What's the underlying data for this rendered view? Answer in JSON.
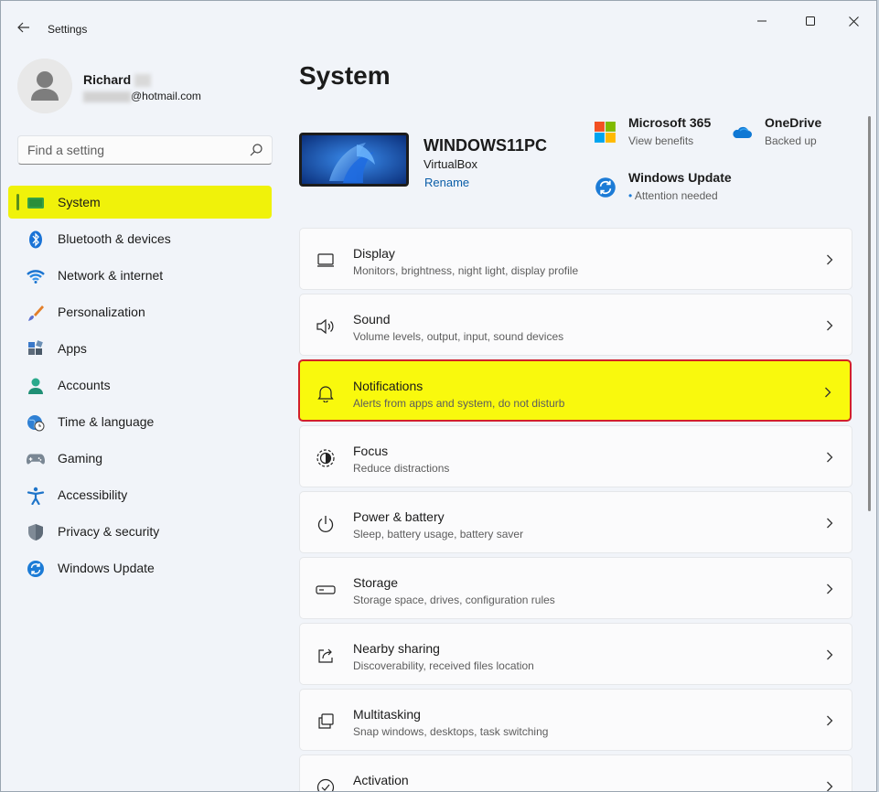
{
  "titlebar": {
    "title": "Settings"
  },
  "profile": {
    "name": "Richard",
    "email_domain": "@hotmail.com"
  },
  "search": {
    "placeholder": "Find a setting",
    "value": ""
  },
  "sidebar": {
    "items": [
      {
        "label": "System",
        "icon": "system-icon",
        "selected": true
      },
      {
        "label": "Bluetooth & devices",
        "icon": "bluetooth-icon"
      },
      {
        "label": "Network & internet",
        "icon": "wifi-icon"
      },
      {
        "label": "Personalization",
        "icon": "brush-icon"
      },
      {
        "label": "Apps",
        "icon": "apps-icon"
      },
      {
        "label": "Accounts",
        "icon": "person-icon"
      },
      {
        "label": "Time & language",
        "icon": "globe-clock-icon"
      },
      {
        "label": "Gaming",
        "icon": "gamepad-icon"
      },
      {
        "label": "Accessibility",
        "icon": "accessibility-icon"
      },
      {
        "label": "Privacy & security",
        "icon": "shield-icon"
      },
      {
        "label": "Windows Update",
        "icon": "update-icon"
      }
    ]
  },
  "main": {
    "title": "System",
    "device": {
      "name": "WINDOWS11PC",
      "model": "VirtualBox",
      "rename": "Rename"
    },
    "quick": {
      "ms365": {
        "title": "Microsoft 365",
        "sub": "View benefits"
      },
      "onedrive": {
        "title": "OneDrive",
        "sub": "Backed up"
      },
      "update": {
        "title": "Windows Update",
        "sub": "Attention needed"
      }
    },
    "cards": [
      {
        "title": "Display",
        "sub": "Monitors, brightness, night light, display profile",
        "icon": "monitor-icon"
      },
      {
        "title": "Sound",
        "sub": "Volume levels, output, input, sound devices",
        "icon": "speaker-icon"
      },
      {
        "title": "Notifications",
        "sub": "Alerts from apps and system, do not disturb",
        "icon": "bell-icon",
        "highlighted": true
      },
      {
        "title": "Focus",
        "sub": "Reduce distractions",
        "icon": "focus-icon"
      },
      {
        "title": "Power & battery",
        "sub": "Sleep, battery usage, battery saver",
        "icon": "power-icon"
      },
      {
        "title": "Storage",
        "sub": "Storage space, drives, configuration rules",
        "icon": "storage-icon"
      },
      {
        "title": "Nearby sharing",
        "sub": "Discoverability, received files location",
        "icon": "share-icon"
      },
      {
        "title": "Multitasking",
        "sub": "Snap windows, desktops, task switching",
        "icon": "multitask-icon"
      },
      {
        "title": "Activation",
        "sub": "",
        "icon": "activation-icon"
      }
    ]
  },
  "colors": {
    "highlight": "#f9f90d",
    "highlight_border": "#d2202a",
    "accent_link": "#0b5ea8",
    "window_bg": "#f1f4f9"
  }
}
